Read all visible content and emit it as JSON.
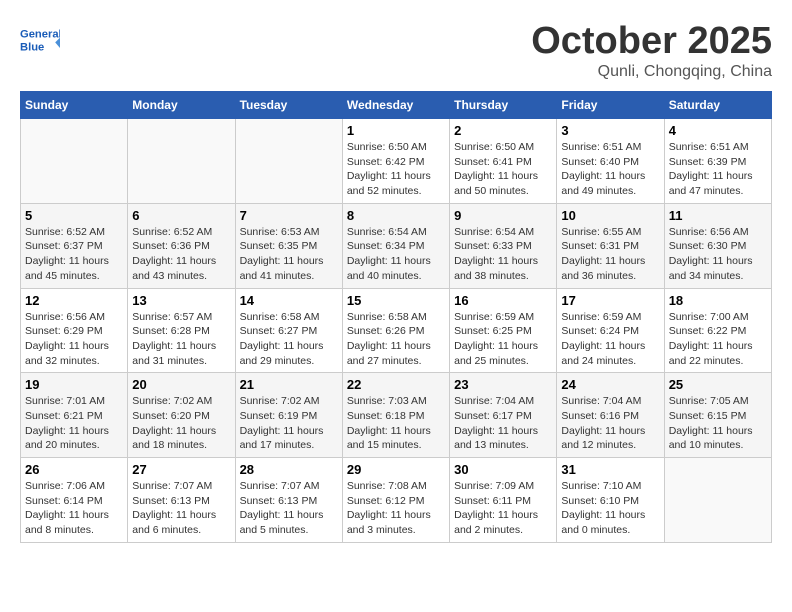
{
  "header": {
    "logo_text_general": "General",
    "logo_text_blue": "Blue",
    "month": "October 2025",
    "location": "Qunli, Chongqing, China"
  },
  "weekdays": [
    "Sunday",
    "Monday",
    "Tuesday",
    "Wednesday",
    "Thursday",
    "Friday",
    "Saturday"
  ],
  "weeks": [
    [
      {
        "day": null,
        "info": null
      },
      {
        "day": null,
        "info": null
      },
      {
        "day": null,
        "info": null
      },
      {
        "day": "1",
        "info": "Sunrise: 6:50 AM\nSunset: 6:42 PM\nDaylight: 11 hours\nand 52 minutes."
      },
      {
        "day": "2",
        "info": "Sunrise: 6:50 AM\nSunset: 6:41 PM\nDaylight: 11 hours\nand 50 minutes."
      },
      {
        "day": "3",
        "info": "Sunrise: 6:51 AM\nSunset: 6:40 PM\nDaylight: 11 hours\nand 49 minutes."
      },
      {
        "day": "4",
        "info": "Sunrise: 6:51 AM\nSunset: 6:39 PM\nDaylight: 11 hours\nand 47 minutes."
      }
    ],
    [
      {
        "day": "5",
        "info": "Sunrise: 6:52 AM\nSunset: 6:37 PM\nDaylight: 11 hours\nand 45 minutes."
      },
      {
        "day": "6",
        "info": "Sunrise: 6:52 AM\nSunset: 6:36 PM\nDaylight: 11 hours\nand 43 minutes."
      },
      {
        "day": "7",
        "info": "Sunrise: 6:53 AM\nSunset: 6:35 PM\nDaylight: 11 hours\nand 41 minutes."
      },
      {
        "day": "8",
        "info": "Sunrise: 6:54 AM\nSunset: 6:34 PM\nDaylight: 11 hours\nand 40 minutes."
      },
      {
        "day": "9",
        "info": "Sunrise: 6:54 AM\nSunset: 6:33 PM\nDaylight: 11 hours\nand 38 minutes."
      },
      {
        "day": "10",
        "info": "Sunrise: 6:55 AM\nSunset: 6:31 PM\nDaylight: 11 hours\nand 36 minutes."
      },
      {
        "day": "11",
        "info": "Sunrise: 6:56 AM\nSunset: 6:30 PM\nDaylight: 11 hours\nand 34 minutes."
      }
    ],
    [
      {
        "day": "12",
        "info": "Sunrise: 6:56 AM\nSunset: 6:29 PM\nDaylight: 11 hours\nand 32 minutes."
      },
      {
        "day": "13",
        "info": "Sunrise: 6:57 AM\nSunset: 6:28 PM\nDaylight: 11 hours\nand 31 minutes."
      },
      {
        "day": "14",
        "info": "Sunrise: 6:58 AM\nSunset: 6:27 PM\nDaylight: 11 hours\nand 29 minutes."
      },
      {
        "day": "15",
        "info": "Sunrise: 6:58 AM\nSunset: 6:26 PM\nDaylight: 11 hours\nand 27 minutes."
      },
      {
        "day": "16",
        "info": "Sunrise: 6:59 AM\nSunset: 6:25 PM\nDaylight: 11 hours\nand 25 minutes."
      },
      {
        "day": "17",
        "info": "Sunrise: 6:59 AM\nSunset: 6:24 PM\nDaylight: 11 hours\nand 24 minutes."
      },
      {
        "day": "18",
        "info": "Sunrise: 7:00 AM\nSunset: 6:22 PM\nDaylight: 11 hours\nand 22 minutes."
      }
    ],
    [
      {
        "day": "19",
        "info": "Sunrise: 7:01 AM\nSunset: 6:21 PM\nDaylight: 11 hours\nand 20 minutes."
      },
      {
        "day": "20",
        "info": "Sunrise: 7:02 AM\nSunset: 6:20 PM\nDaylight: 11 hours\nand 18 minutes."
      },
      {
        "day": "21",
        "info": "Sunrise: 7:02 AM\nSunset: 6:19 PM\nDaylight: 11 hours\nand 17 minutes."
      },
      {
        "day": "22",
        "info": "Sunrise: 7:03 AM\nSunset: 6:18 PM\nDaylight: 11 hours\nand 15 minutes."
      },
      {
        "day": "23",
        "info": "Sunrise: 7:04 AM\nSunset: 6:17 PM\nDaylight: 11 hours\nand 13 minutes."
      },
      {
        "day": "24",
        "info": "Sunrise: 7:04 AM\nSunset: 6:16 PM\nDaylight: 11 hours\nand 12 minutes."
      },
      {
        "day": "25",
        "info": "Sunrise: 7:05 AM\nSunset: 6:15 PM\nDaylight: 11 hours\nand 10 minutes."
      }
    ],
    [
      {
        "day": "26",
        "info": "Sunrise: 7:06 AM\nSunset: 6:14 PM\nDaylight: 11 hours\nand 8 minutes."
      },
      {
        "day": "27",
        "info": "Sunrise: 7:07 AM\nSunset: 6:13 PM\nDaylight: 11 hours\nand 6 minutes."
      },
      {
        "day": "28",
        "info": "Sunrise: 7:07 AM\nSunset: 6:13 PM\nDaylight: 11 hours\nand 5 minutes."
      },
      {
        "day": "29",
        "info": "Sunrise: 7:08 AM\nSunset: 6:12 PM\nDaylight: 11 hours\nand 3 minutes."
      },
      {
        "day": "30",
        "info": "Sunrise: 7:09 AM\nSunset: 6:11 PM\nDaylight: 11 hours\nand 2 minutes."
      },
      {
        "day": "31",
        "info": "Sunrise: 7:10 AM\nSunset: 6:10 PM\nDaylight: 11 hours\nand 0 minutes."
      },
      {
        "day": null,
        "info": null
      }
    ]
  ]
}
